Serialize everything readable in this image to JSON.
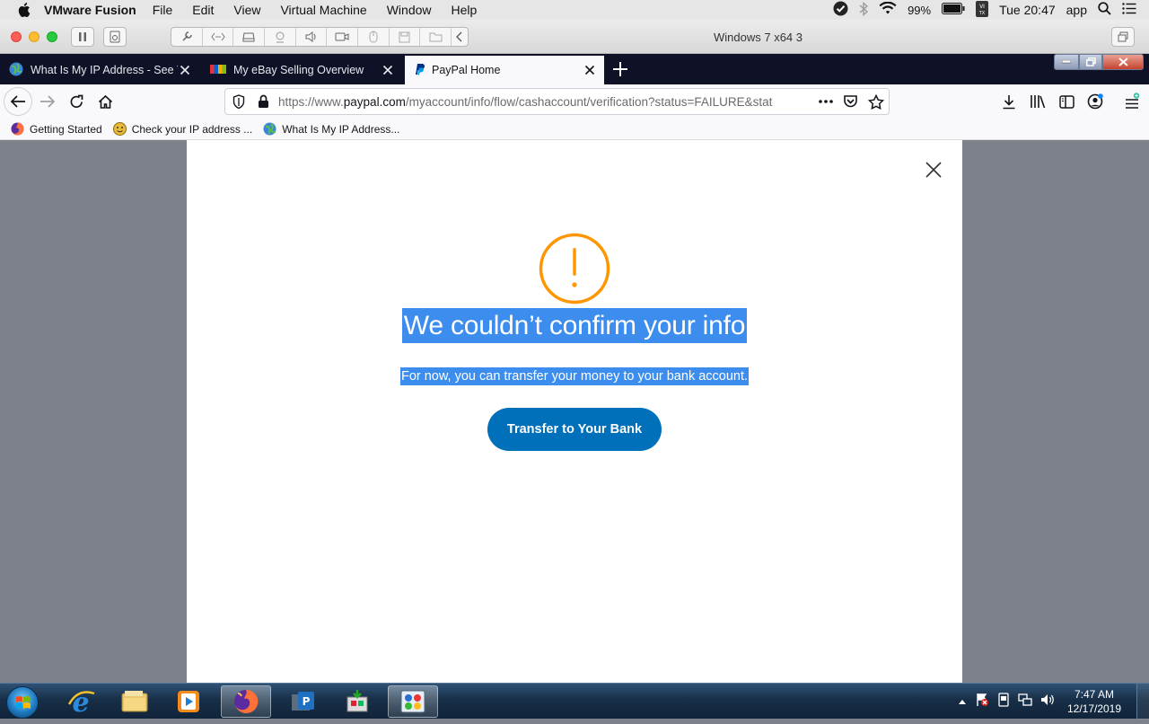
{
  "mac_menubar": {
    "app_name": "VMware Fusion",
    "menus": [
      "File",
      "Edit",
      "View",
      "Virtual Machine",
      "Window",
      "Help"
    ],
    "battery": "99%",
    "clock": "Tue 20:47",
    "user": "app"
  },
  "vm_toolbar": {
    "title": "Windows 7 x64 3"
  },
  "tabs": [
    {
      "title": "What Is My IP Address - See Your",
      "active": false
    },
    {
      "title": "My eBay Selling Overview",
      "active": false
    },
    {
      "title": "PayPal Home",
      "active": true
    }
  ],
  "urlbar": {
    "prefix": "https://www.",
    "domain": "paypal.com",
    "path": "/myaccount/info/flow/cashaccount/verification?status=FAILURE&stat"
  },
  "bookmarks": [
    {
      "label": "Getting Started"
    },
    {
      "label": "Check your IP address ..."
    },
    {
      "label": "What Is My IP Address..."
    }
  ],
  "modal": {
    "title": "We couldn’t confirm your info",
    "subtitle": "For now, you can transfer your money to your bank account.",
    "button_label": "Transfer to Your Bank"
  },
  "taskbar": {
    "time": "7:47 AM",
    "date": "12/17/2019"
  },
  "colors": {
    "paypal_blue": "#0070ba",
    "alert_orange": "#ff9600",
    "selection": "#3c8dee"
  }
}
